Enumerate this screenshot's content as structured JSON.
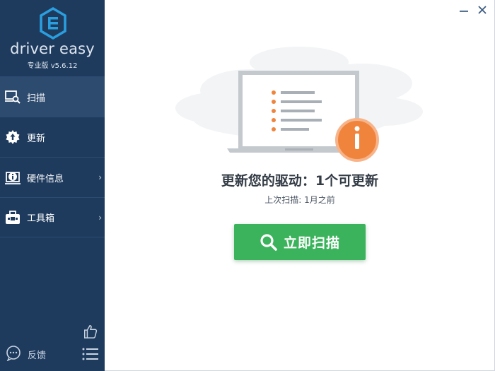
{
  "brand": {
    "name": "driver easy",
    "edition": "专业版 v5.6.12"
  },
  "sidebar": {
    "items": [
      {
        "label": "扫描",
        "icon": "scan-monitor-icon"
      },
      {
        "label": "更新",
        "icon": "gear-update-icon"
      },
      {
        "label": "硬件信息",
        "icon": "hardware-info-icon",
        "chevron": "›"
      },
      {
        "label": "工具箱",
        "icon": "toolbox-icon",
        "chevron": "›"
      }
    ],
    "feedback_label": "反馈"
  },
  "main": {
    "headline": "更新您的驱动：1个可更新",
    "last_scan": "上次扫描: 1月之前",
    "scan_button_label": "立即扫描"
  },
  "colors": {
    "sidebar_bg": "#1e3b5e",
    "sidebar_active": "#2d4a6f",
    "accent_green": "#3bb35c",
    "accent_orange": "#f0843c",
    "logo_blue": "#2a9fe0"
  }
}
